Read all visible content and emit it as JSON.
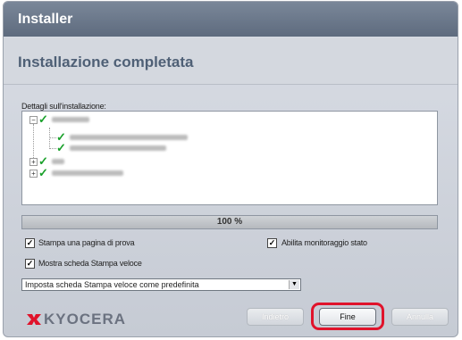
{
  "window": {
    "title": "Installer",
    "heading": "Installazione completata"
  },
  "details": {
    "label": "Dettagli sull'installazione:"
  },
  "progress": {
    "percent": 100,
    "label": "100 %"
  },
  "options": {
    "print_test_page": {
      "label": "Stampa una pagina di prova",
      "checked": true
    },
    "enable_status_monitor": {
      "label": "Abilita monitoraggio stato",
      "checked": true
    },
    "show_quick_print": {
      "label": "Mostra scheda Stampa veloce",
      "checked": true
    }
  },
  "quick_print_select": {
    "selected": "Imposta scheda Stampa veloce come predefinita"
  },
  "brand": {
    "name": "KYOCERA"
  },
  "buttons": {
    "back": "Indietro",
    "finish": "Fine",
    "cancel": "Annulla"
  },
  "colors": {
    "brand_red": "#e0132b",
    "check_green": "#19a02a",
    "title_bar": "#6b778a"
  },
  "icons": {
    "success": "check-icon",
    "expand": "expand-icon",
    "collapse": "collapse-icon",
    "dropdown": "chevron-down-icon"
  }
}
